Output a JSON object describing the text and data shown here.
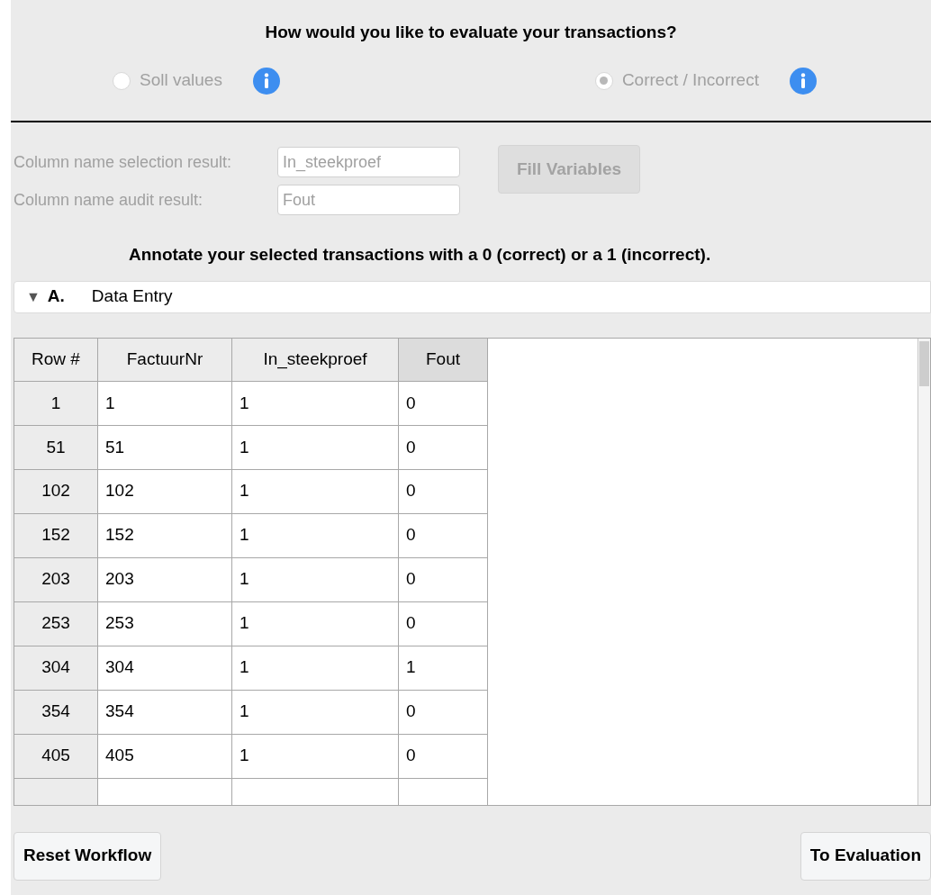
{
  "heading": "How would you like to evaluate your transactions?",
  "evaluation_options": [
    {
      "label": "Soll values",
      "selected": false,
      "disabled": true
    },
    {
      "label": "Correct / Incorrect",
      "selected": true,
      "disabled": true
    }
  ],
  "fields": [
    {
      "label": "Column name selection result:",
      "value": "In_steekproef"
    },
    {
      "label": "Column name audit result:",
      "value": "Fout"
    }
  ],
  "fill_button": {
    "label": "Fill Variables",
    "disabled": true
  },
  "instruction": "Annotate your selected transactions with a 0 (correct) or a 1 (incorrect).",
  "section": {
    "toggle": "▼",
    "letter": "A.",
    "title": "Data Entry",
    "expanded": true
  },
  "table": {
    "columns": [
      {
        "label": "Row #",
        "highlighted": false
      },
      {
        "label": "FactuurNr",
        "highlighted": false
      },
      {
        "label": "In_steekproef",
        "highlighted": false
      },
      {
        "label": "Fout",
        "highlighted": true
      }
    ],
    "rows": [
      [
        "1",
        "1",
        "1",
        "0"
      ],
      [
        "51",
        "51",
        "1",
        "0"
      ],
      [
        "102",
        "102",
        "1",
        "0"
      ],
      [
        "152",
        "152",
        "1",
        "0"
      ],
      [
        "203",
        "203",
        "1",
        "0"
      ],
      [
        "253",
        "253",
        "1",
        "0"
      ],
      [
        "304",
        "304",
        "1",
        "1"
      ],
      [
        "354",
        "354",
        "1",
        "0"
      ],
      [
        "405",
        "405",
        "1",
        "0"
      ]
    ]
  },
  "buttons": [
    {
      "label": "Reset Workflow"
    },
    {
      "label": "To Evaluation"
    }
  ]
}
